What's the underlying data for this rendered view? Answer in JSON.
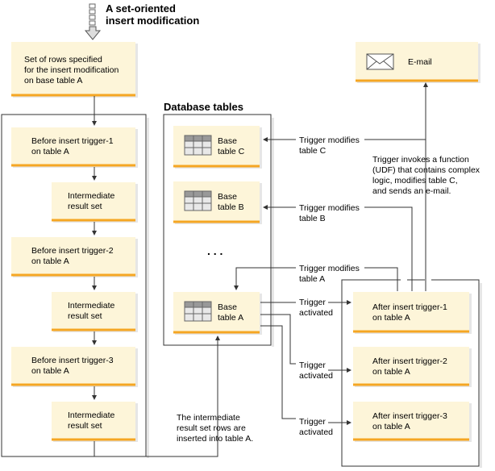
{
  "title": [
    "A set-oriented",
    "insert modification"
  ],
  "start_box": [
    "Set of rows specified",
    "for the insert modification",
    "on base table A"
  ],
  "before_triggers": [
    [
      "Before insert trigger-1",
      "on table A"
    ],
    [
      "Before insert trigger-2",
      "on table A"
    ],
    [
      "Before insert trigger-3",
      "on table A"
    ]
  ],
  "intermediate": [
    "Intermediate",
    "result set"
  ],
  "db_title": "Database tables",
  "tables": {
    "c": [
      "Base",
      "table C"
    ],
    "b": [
      "Base",
      "table B"
    ],
    "a": [
      "Base",
      "table A"
    ],
    "ellipsis": ". . ."
  },
  "email": "E-mail",
  "udf_note": [
    "Trigger invokes a function",
    "(UDF) that contains complex",
    "logic, modifies table C,",
    "and sends an e-mail."
  ],
  "modifies": {
    "c": [
      "Trigger modifies",
      "table C"
    ],
    "b": [
      "Trigger modifies",
      "table B"
    ],
    "a": [
      "Trigger modifies",
      "table A"
    ]
  },
  "activated": [
    "Trigger",
    "activated"
  ],
  "after_triggers": [
    [
      "After insert trigger-1",
      "on table A"
    ],
    [
      "After insert trigger-2",
      "on table A"
    ],
    [
      "After insert trigger-3",
      "on table A"
    ]
  ],
  "insert_note": [
    "The intermediate",
    "result set rows are",
    "inserted into table A."
  ],
  "colors": {
    "box_fill": "#fdf5d9",
    "box_border": "#f5a623"
  }
}
